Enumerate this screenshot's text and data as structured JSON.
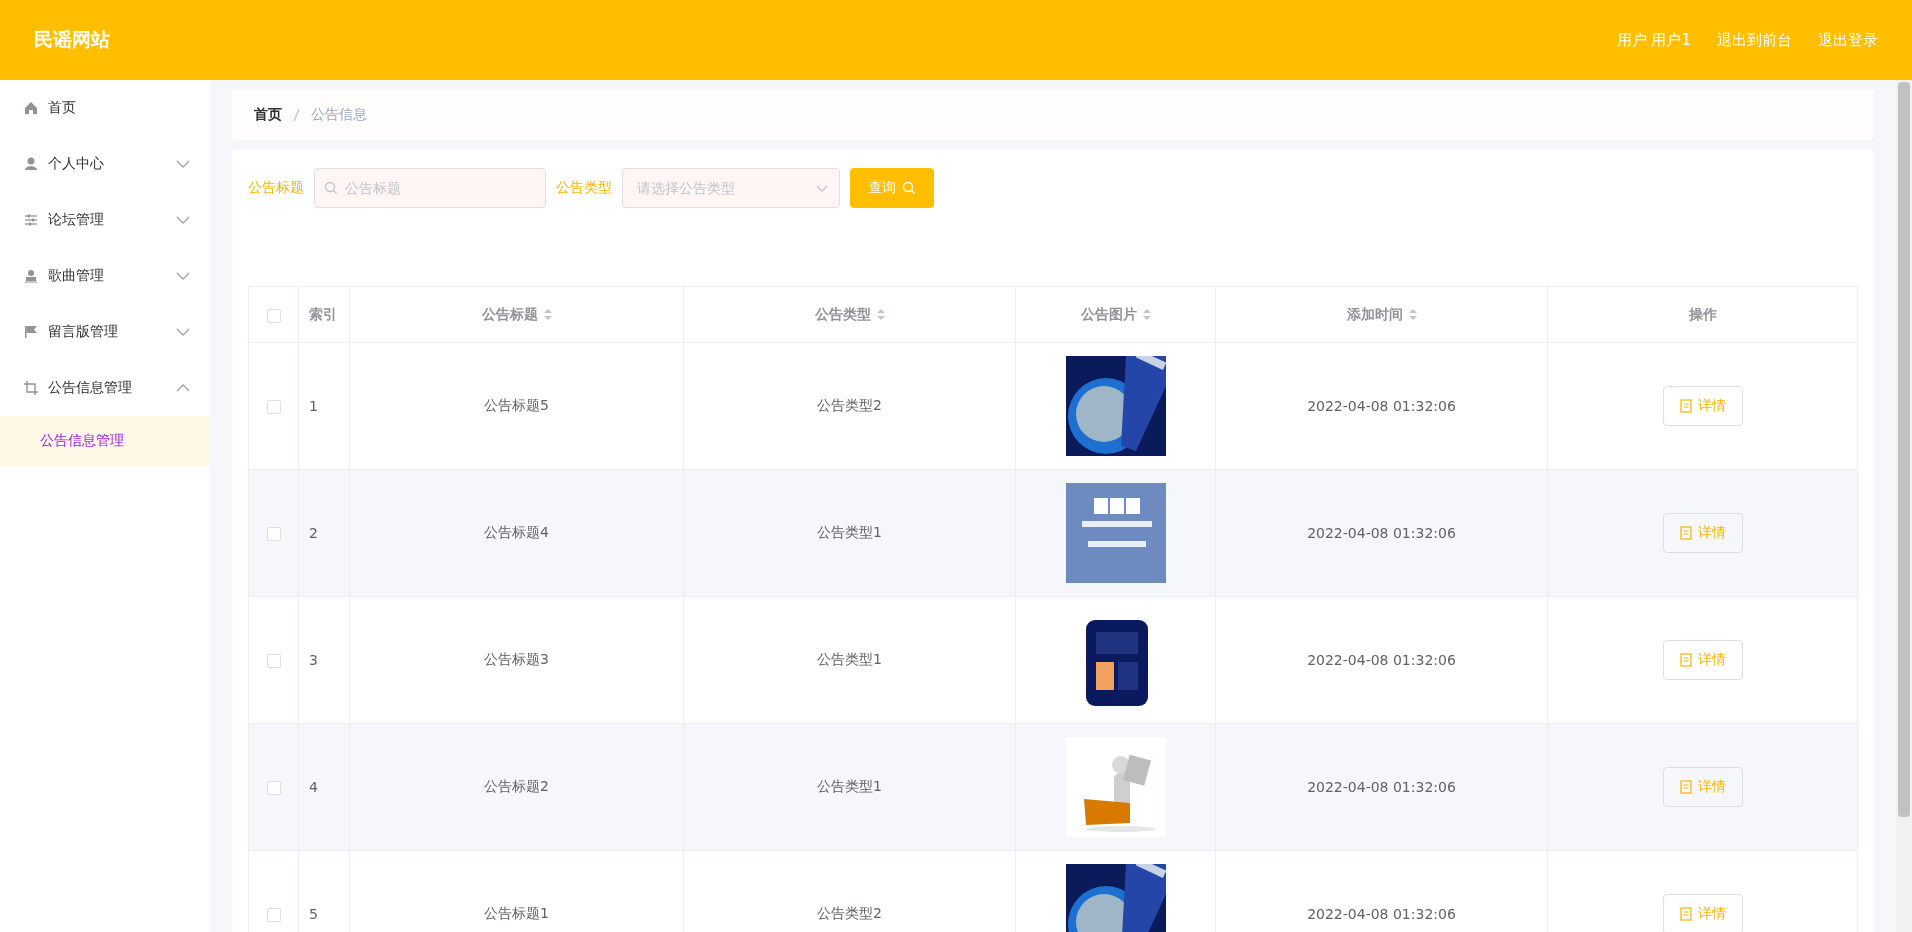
{
  "header": {
    "title": "民谣网站",
    "links": [
      "用户 用户1",
      "退出到前台",
      "退出登录"
    ]
  },
  "sidebar": {
    "items": [
      {
        "label": "首页"
      },
      {
        "label": "个人中心",
        "expanded": false
      },
      {
        "label": "论坛管理",
        "expanded": false
      },
      {
        "label": "歌曲管理",
        "expanded": false
      },
      {
        "label": "留言版管理",
        "expanded": false
      },
      {
        "label": "公告信息管理",
        "expanded": true,
        "children": [
          {
            "label": "公告信息管理",
            "selected": true
          }
        ]
      }
    ]
  },
  "breadcrumb": [
    "首页",
    "公告信息"
  ],
  "search": {
    "title_label": "公告标题",
    "title_placeholder": "公告标题",
    "type_label": "公告类型",
    "type_placeholder": "请选择公告类型",
    "button": "查询"
  },
  "table": {
    "columns": [
      {
        "kind": "checkbox",
        "checked": false
      },
      {
        "label": "索引",
        "kind": "text",
        "sortable": false
      },
      {
        "label": "公告标题",
        "kind": "text",
        "sortable": true
      },
      {
        "label": "公告类型",
        "kind": "text",
        "sortable": true
      },
      {
        "label": "公告图片",
        "kind": "text",
        "sortable": true
      },
      {
        "label": "添加时间",
        "kind": "text",
        "sortable": true
      },
      {
        "label": "操作",
        "kind": "text",
        "sortable": false
      }
    ],
    "rows": [
      {
        "checked": false,
        "index": "1",
        "title": "公告标题5",
        "type": "公告类型2",
        "time": "2022-04-08 01:32:06",
        "action": "详情"
      },
      {
        "checked": false,
        "index": "2",
        "title": "公告标题4",
        "type": "公告类型1",
        "time": "2022-04-08 01:32:06",
        "action": "详情"
      },
      {
        "checked": false,
        "index": "3",
        "title": "公告标题3",
        "type": "公告类型1",
        "time": "2022-04-08 01:32:06",
        "action": "详情"
      },
      {
        "checked": false,
        "index": "4",
        "title": "公告标题2",
        "type": "公告类型1",
        "time": "2022-04-08 01:32:06",
        "action": "详情"
      },
      {
        "checked": false,
        "index": "5",
        "title": "公告标题1",
        "type": "公告类型2",
        "time": "2022-04-08 01:32:06",
        "action": "详情"
      }
    ]
  }
}
